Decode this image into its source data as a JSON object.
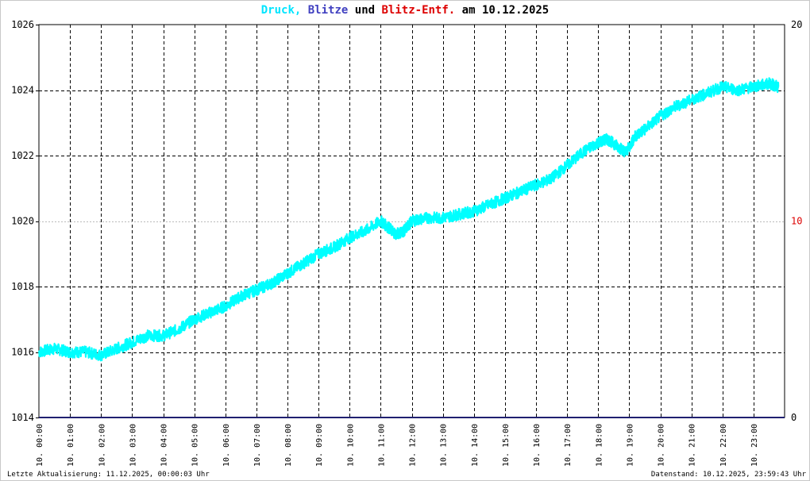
{
  "title": {
    "series1": "Druck,",
    "series2": "Blitze",
    "joiner": "und",
    "series3": "Blitz-Entf.",
    "date_prefix": "am",
    "date": "10.12.2025"
  },
  "footer": {
    "left": "Letzte Aktualisierung: 11.12.2025, 00:00:03 Uhr",
    "right": "Datenstand: 10.12.2025, 23:59:43 Uhr"
  },
  "colors": {
    "pressure": "#00ffff",
    "lightning": "#4040c0",
    "distance": "#dd0000",
    "baseline": "#202070",
    "grid": "#000000",
    "midgrid": "#bbbbbb"
  },
  "chart_data": {
    "type": "line",
    "x_tick_labels": [
      "10. 00:00",
      "10. 01:00",
      "10. 02:00",
      "10. 03:00",
      "10. 04:00",
      "10. 05:00",
      "10. 06:00",
      "10. 07:00",
      "10. 08:00",
      "10. 09:00",
      "10. 10:00",
      "10. 11:00",
      "10. 12:00",
      "10. 13:00",
      "10. 14:00",
      "10. 15:00",
      "10. 16:00",
      "10. 17:00",
      "10. 18:00",
      "10. 19:00",
      "10. 20:00",
      "10. 21:00",
      "10. 22:00",
      "10. 23:00"
    ],
    "xlim": [
      0,
      24
    ],
    "y_left": {
      "ylim": [
        1014,
        1026
      ],
      "ticks": [
        "1014",
        "1016",
        "1018",
        "1020",
        "1022",
        "1024",
        "1026"
      ]
    },
    "y_right": {
      "ylim": [
        0,
        20
      ],
      "ticks": [
        "0",
        "10",
        "20"
      ]
    },
    "series": [
      {
        "name": "Druck",
        "axis": "left",
        "x": [
          0,
          0.5,
          1,
          1.5,
          2,
          2.5,
          3,
          3.5,
          4,
          4.5,
          5,
          5.5,
          6,
          6.5,
          7,
          7.5,
          8,
          8.5,
          9,
          9.5,
          10,
          10.5,
          11,
          11.25,
          11.5,
          11.75,
          12,
          12.5,
          13,
          13.5,
          14,
          14.5,
          15,
          15.5,
          16,
          16.5,
          17,
          17.5,
          18,
          18.3,
          18.6,
          18.9,
          19.2,
          19.5,
          20,
          20.5,
          21,
          21.5,
          22,
          22.5,
          23,
          23.5,
          23.8
        ],
        "y": [
          1016.0,
          1016.1,
          1016.0,
          1016.0,
          1015.9,
          1016.1,
          1016.3,
          1016.5,
          1016.5,
          1016.7,
          1017.0,
          1017.2,
          1017.4,
          1017.7,
          1017.9,
          1018.1,
          1018.4,
          1018.7,
          1019.0,
          1019.2,
          1019.5,
          1019.7,
          1020.0,
          1019.8,
          1019.6,
          1019.7,
          1020.0,
          1020.1,
          1020.1,
          1020.2,
          1020.3,
          1020.5,
          1020.7,
          1020.9,
          1021.1,
          1021.3,
          1021.7,
          1022.1,
          1022.4,
          1022.5,
          1022.3,
          1022.1,
          1022.6,
          1022.8,
          1023.2,
          1023.5,
          1023.7,
          1023.9,
          1024.1,
          1024.0,
          1024.1,
          1024.2,
          1024.1
        ]
      },
      {
        "name": "Blitze",
        "axis": "right",
        "x": [
          0,
          24
        ],
        "y": [
          0,
          0
        ]
      },
      {
        "name": "Blitz-Entf.",
        "axis": "right",
        "x": [],
        "y": []
      }
    ]
  }
}
